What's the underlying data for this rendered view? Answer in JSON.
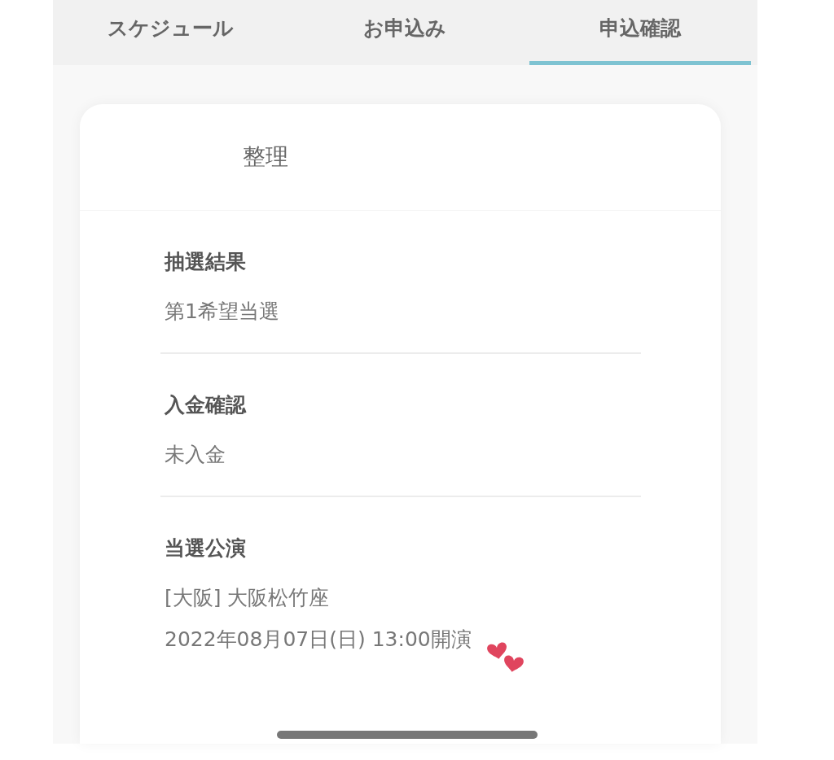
{
  "tabs": [
    {
      "label": "スケジュール",
      "selected": false
    },
    {
      "label": "お申込み",
      "selected": false
    },
    {
      "label": "申込確認",
      "selected": true
    }
  ],
  "card": {
    "title": "整理",
    "sections": [
      {
        "label": "抽選結果",
        "lines": [
          "第1希望当選"
        ]
      },
      {
        "label": "入金確認",
        "lines": [
          "未入金"
        ]
      },
      {
        "label": "当選公演",
        "lines": [
          "[大阪] 大阪松竹座",
          "2022年08月07日(日) 13:00開演"
        ]
      }
    ]
  }
}
